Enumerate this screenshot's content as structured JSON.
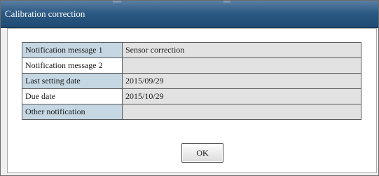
{
  "dialog": {
    "title": "Calibration correction"
  },
  "rows": [
    {
      "label": "Notification message 1",
      "value": "Sensor correction"
    },
    {
      "label": "Notification message 2",
      "value": ""
    },
    {
      "label": "Last setting date",
      "value": "2015/09/29"
    },
    {
      "label": "Due date",
      "value": "2015/10/29"
    },
    {
      "label": "Other notification",
      "value": ""
    }
  ],
  "buttons": {
    "ok_label": "OK"
  }
}
